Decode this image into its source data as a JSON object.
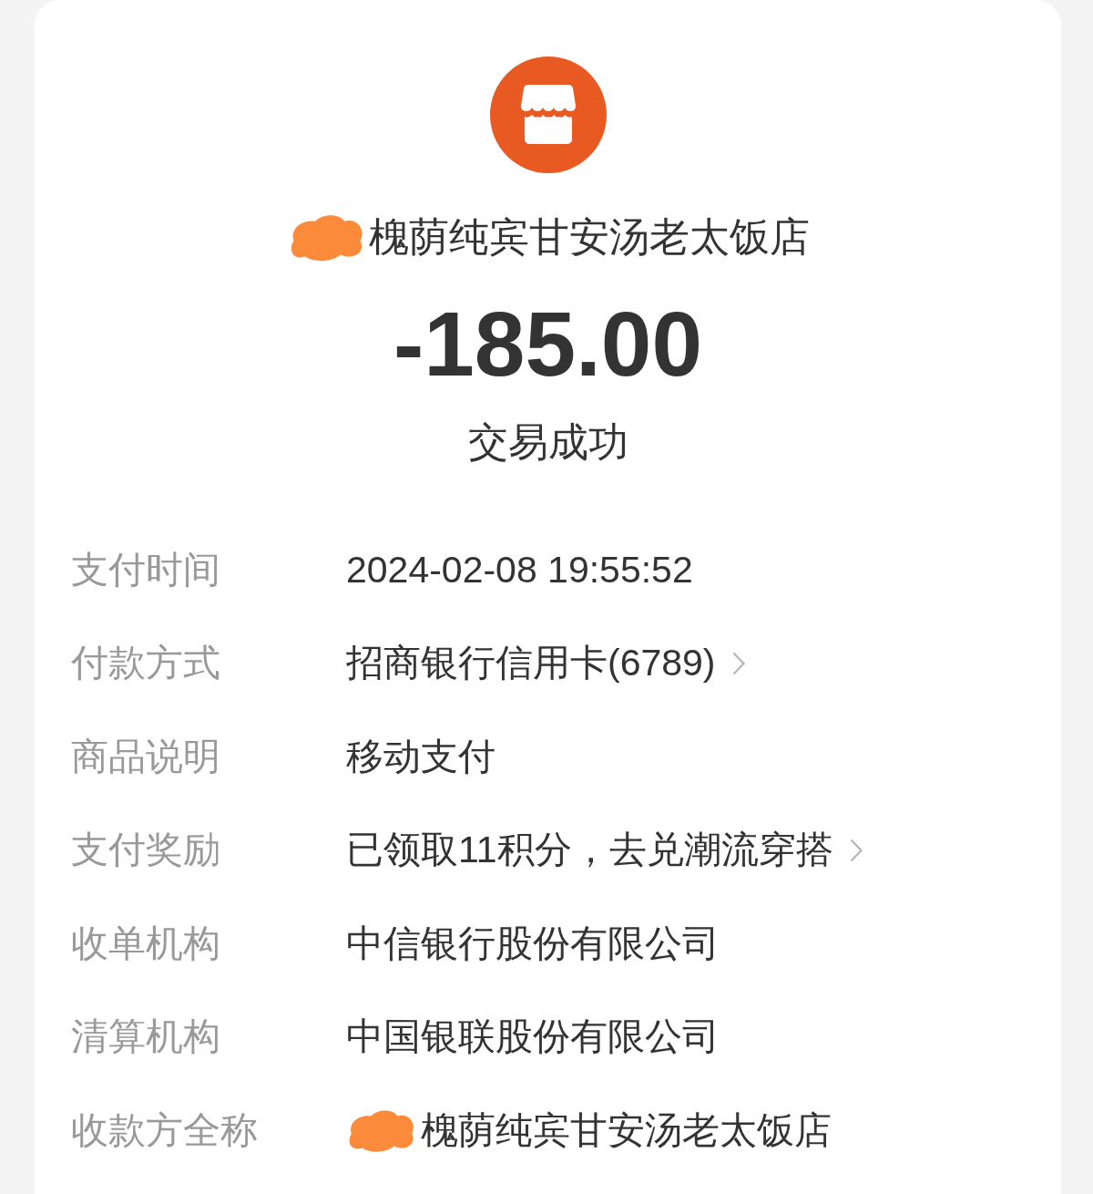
{
  "merchant": {
    "redacted": true,
    "name": "槐荫纯宾甘安汤老太饭店"
  },
  "amount": "-185.00",
  "status": "交易成功",
  "details": [
    {
      "label": "支付时间",
      "value": "2024-02-08 19:55:52",
      "linked": false,
      "redacted": false
    },
    {
      "label": "付款方式",
      "value": "招商银行信用卡(6789)",
      "linked": true,
      "redacted": false
    },
    {
      "label": "商品说明",
      "value": "移动支付",
      "linked": false,
      "redacted": false
    },
    {
      "label": "支付奖励",
      "value": "已领取11积分，去兑潮流穿搭",
      "linked": true,
      "redacted": false
    },
    {
      "label": "收单机构",
      "value": "中信银行股份有限公司",
      "linked": false,
      "redacted": false
    },
    {
      "label": "清算机构",
      "value": "中国银联股份有限公司",
      "linked": false,
      "redacted": false
    },
    {
      "label": "收款方全称",
      "value": "槐荫纯宾甘安汤老太饭店",
      "linked": false,
      "redacted": true
    }
  ]
}
